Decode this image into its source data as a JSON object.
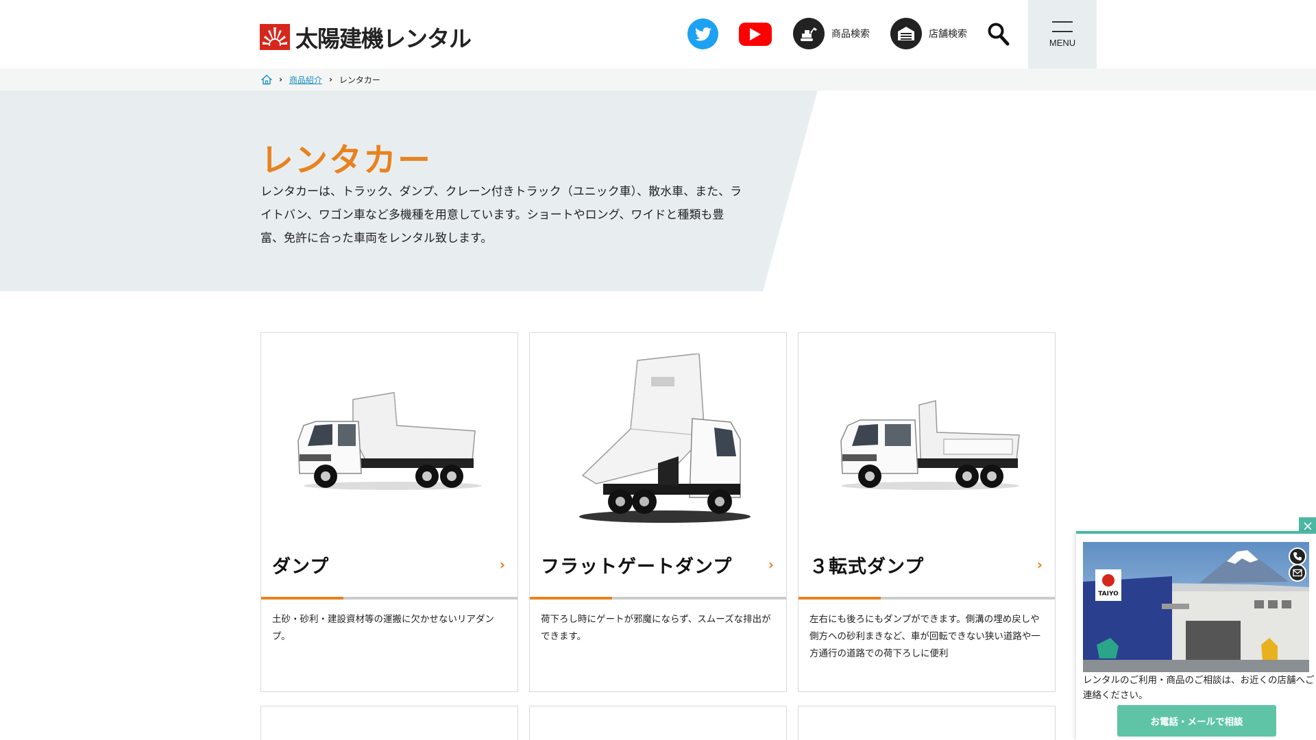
{
  "header": {
    "brand": "太陽建機レンタル",
    "nav": {
      "product_search": "商品検索",
      "store_search": "店舗検索",
      "menu": "MENU"
    },
    "colors": {
      "twitter": "#1da1f2",
      "youtube": "#ff0000",
      "menu_bg": "#e8eef0"
    }
  },
  "breadcrumb": {
    "items": [
      "商品紹介",
      "レンタカー"
    ]
  },
  "hero": {
    "title": "レンタカー",
    "description": "レンタカーは、トラック、ダンプ、クレーン付きトラック（ユニック車）、散水車、また、ライトバン、ワゴン車など多機種を用意しています。ショートやロング、ワイドと種類も豊富、免許に合った車両をレンタル致します。",
    "colors": {
      "title": "#e8821e",
      "bg": "#e8eef0"
    }
  },
  "cards": [
    {
      "title": "ダンプ",
      "description": "土砂・砂利・建設資材等の運搬に欠かせないリアダンプ。"
    },
    {
      "title": "フラットゲートダンプ",
      "description": "荷下ろし時にゲートが邪魔にならず、スムーズな排出ができます。"
    },
    {
      "title": "３転式ダンプ",
      "description": "左右にも後ろにもダンプができます。側溝の埋め戻しや側方への砂利まきなど、車が回転できない狭い道路や一方通行の道路での荷下ろしに便利"
    }
  ],
  "popup": {
    "photo_sign": "TAIYO",
    "text": "レンタルのご利用・商品のご相談は、お近くの店舗へご連絡ください。",
    "button": "お電話・メールで相談",
    "color": "#4cb8a4"
  }
}
